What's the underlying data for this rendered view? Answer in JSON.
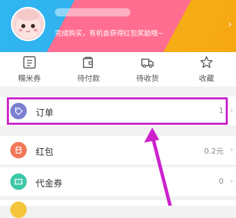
{
  "header": {
    "promo_text": "完成购买，有机会获得红包奖励哦~",
    "chevron": "›"
  },
  "quick_menu": [
    {
      "label": "糯米券",
      "icon": "ticket-icon"
    },
    {
      "label": "待付款",
      "icon": "wallet-icon"
    },
    {
      "label": "待收货",
      "icon": "truck-icon"
    },
    {
      "label": "收藏",
      "icon": "star-icon"
    }
  ],
  "rows": {
    "order": {
      "label": "订单",
      "value": "1",
      "icon": "tag-icon",
      "color": "#7b7fd0"
    },
    "red_packet": {
      "label": "红包",
      "value": "0.2元",
      "icon": "red-packet-icon",
      "color": "#f2785a"
    },
    "voucher": {
      "label": "代金券",
      "value": "0",
      "icon": "voucher-icon",
      "color": "#3cc7a8"
    }
  },
  "arrow": "›",
  "colors": {
    "annotation": "#cc22cc",
    "header_blue": "#30b6f0",
    "header_pink": "#ff6e90",
    "header_yellow": "#f8b21a"
  }
}
